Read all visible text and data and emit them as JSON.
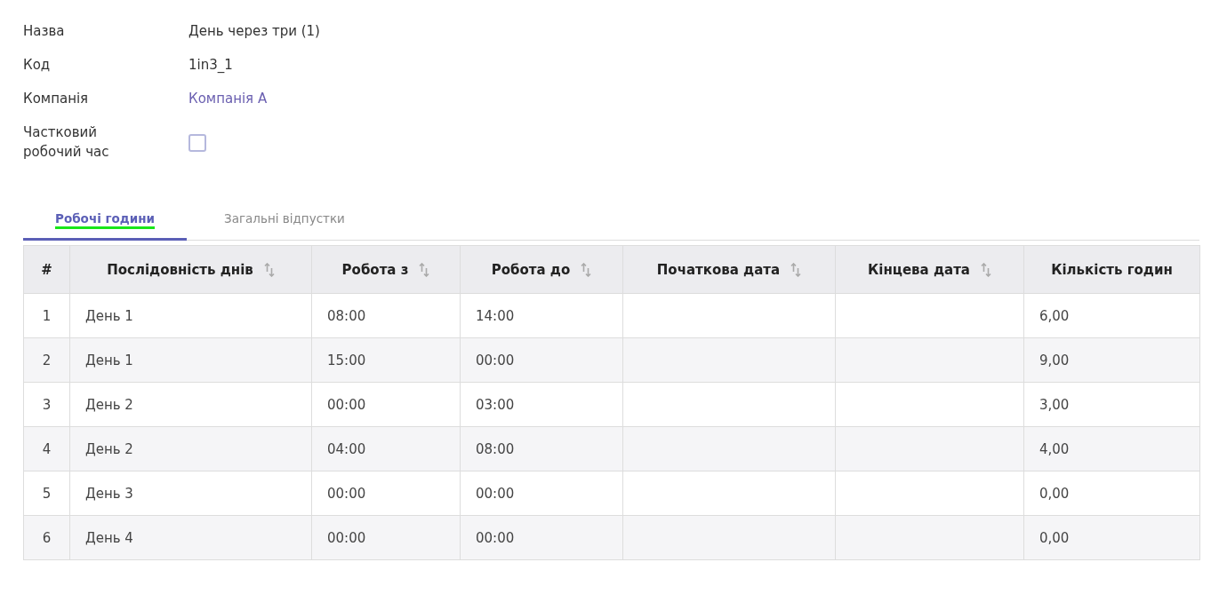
{
  "fields": [
    {
      "label": "Назва",
      "kind": "text",
      "value": "День через три (1)"
    },
    {
      "label": "Код",
      "kind": "text",
      "value": "1in3_1"
    },
    {
      "label": "Компанія",
      "kind": "link",
      "value": "Компанія А"
    },
    {
      "label": "Частковий робочий час",
      "kind": "checkbox",
      "checked": false
    }
  ],
  "tabs": [
    {
      "label": "Робочі години",
      "selected": true
    },
    {
      "label": "Загальні відпустки",
      "selected": false
    }
  ],
  "table": {
    "columns": [
      {
        "label": "#",
        "sortable": false
      },
      {
        "label": "Послідовність днів",
        "sortable": true
      },
      {
        "label": "Робота з",
        "sortable": true
      },
      {
        "label": "Робота до",
        "sortable": true
      },
      {
        "label": "Початкова дата",
        "sortable": true
      },
      {
        "label": "Кінцева дата",
        "sortable": true
      },
      {
        "label": "Кількість годин",
        "sortable": false
      }
    ],
    "rows": [
      [
        "1",
        "День 1",
        "08:00",
        "14:00",
        "",
        "",
        "6,00"
      ],
      [
        "2",
        "День 1",
        "15:00",
        "00:00",
        "",
        "",
        "9,00"
      ],
      [
        "3",
        "День 2",
        "00:00",
        "03:00",
        "",
        "",
        "3,00"
      ],
      [
        "4",
        "День 2",
        "04:00",
        "08:00",
        "",
        "",
        "4,00"
      ],
      [
        "5",
        "День 3",
        "00:00",
        "00:00",
        "",
        "",
        "0,00"
      ],
      [
        "6",
        "День 4",
        "00:00",
        "00:00",
        "",
        "",
        "0,00"
      ]
    ]
  }
}
